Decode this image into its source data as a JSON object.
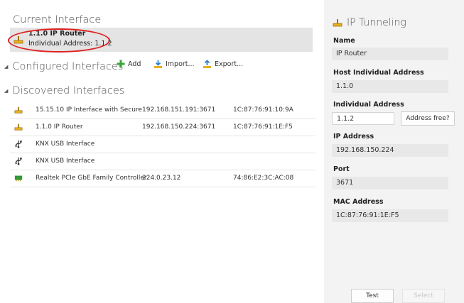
{
  "current": {
    "title": "Current Interface",
    "name": "1.1.0 IP Router",
    "address": "Individual Address: 1.1.2"
  },
  "configured": {
    "title": "Configured Interfaces",
    "add_label": "Add",
    "import_label": "Import...",
    "export_label": "Export..."
  },
  "discovered": {
    "title": "Discovered Interfaces",
    "rows": [
      {
        "icon": "ip-router-icon",
        "name": "15.15.10 IP Interface with Secure",
        "ip": "192.168.151.191:3671",
        "mac": "1C:87:76:91:10:9A"
      },
      {
        "icon": "ip-router-icon",
        "name": "1.1.0 IP Router",
        "ip": "192.168.150.224:3671",
        "mac": "1C:87:76:91:1E:F5"
      },
      {
        "icon": "usb-icon",
        "name": "KNX USB Interface",
        "ip": "",
        "mac": ""
      },
      {
        "icon": "usb-icon",
        "name": "KNX USB Interface",
        "ip": "",
        "mac": ""
      },
      {
        "icon": "network-card-icon",
        "name": "Realtek PCIe GbE Family Controller",
        "ip": "224.0.23.12",
        "mac": "74:86:E2:3C:AC:08"
      }
    ]
  },
  "panel": {
    "title": "IP Tunneling",
    "name_label": "Name",
    "name_value": "IP Router",
    "host_label": "Host Individual Address",
    "host_value": "1.1.0",
    "ind_label": "Individual Address",
    "ind_value": "1.1.2",
    "address_free_label": "Address free?",
    "ip_label": "IP Address",
    "ip_value": "192.168.150.224",
    "port_label": "Port",
    "port_value": "3671",
    "mac_label": "MAC Address",
    "mac_value": "1C:87:76:91:1E:F5",
    "test_label": "Test",
    "select_label": "Select"
  },
  "colors": {
    "highlight_oval": "#e02020",
    "add_green": "#3aa53a",
    "import_blue": "#2a7fd4",
    "router_icon_yellow": "#e8b020"
  }
}
